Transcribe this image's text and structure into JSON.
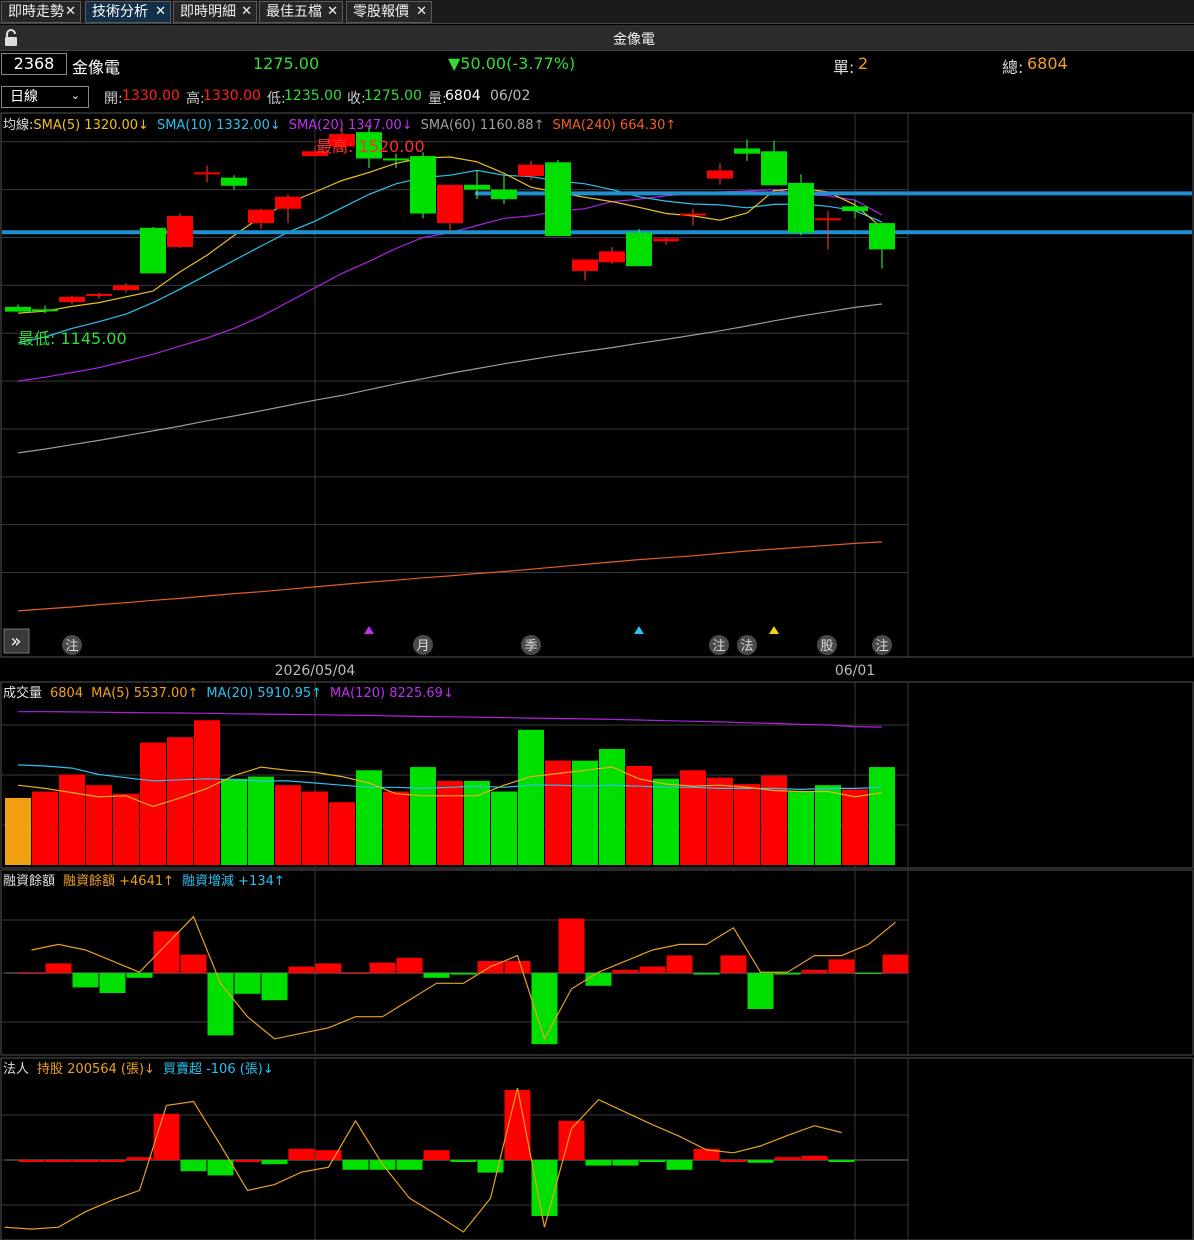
{
  "tabs": [
    {
      "label": "即時走勢",
      "active": false
    },
    {
      "label": "技術分析",
      "active": true
    },
    {
      "label": "即時明細",
      "active": false
    },
    {
      "label": "最佳五檔",
      "active": false
    },
    {
      "label": "零股報價",
      "active": false
    }
  ],
  "close_glyph": "✕",
  "window_title": "金像電",
  "quote": {
    "code": "2368",
    "name": "金像電",
    "price": "1275.00",
    "change": "▼50.00(-3.77%)",
    "single_label": "單:",
    "single_value": "2",
    "total_label": "總:",
    "total_value": "6804"
  },
  "bar": {
    "period": "日線",
    "open_label": "開:",
    "open": "1330.00",
    "high_label": "高:",
    "high": "1330.00",
    "low_label": "低:",
    "low": "1235.00",
    "close_label": "收:",
    "close": "1275.00",
    "vol_label": "量:",
    "vol": "6804",
    "date": "06/02"
  },
  "price_panel": {
    "legend": [
      {
        "text": "均線:",
        "color": "#e0e0e0"
      },
      {
        "text": "SMA(5) 1320.00↓",
        "color": "#f0c020"
      },
      {
        "text": "SMA(10) 1332.00↓",
        "color": "#2ec0f0"
      },
      {
        "text": "SMA(20) 1347.00↓",
        "color": "#c030f0"
      },
      {
        "text": "SMA(60) 1160.88↑",
        "color": "#a0a0a0"
      },
      {
        "text": "SMA(240) 664.30↑",
        "color": "#f06020"
      }
    ],
    "max_label": "最高: 1520.00",
    "min_label": "最低: 1145.00",
    "event_badges": [
      "注",
      "月",
      "季",
      "注",
      "法",
      "股",
      "注"
    ],
    "nav_glyph": "»",
    "x_labels": [
      "2026/05/04",
      "06/01"
    ]
  },
  "volume_panel": {
    "legend": [
      {
        "text": "成交量",
        "color": "#e0e0e0"
      },
      {
        "text": "6804",
        "color": "#f0a020"
      },
      {
        "text": "MA(5) 5537.00↑",
        "color": "#f0a020"
      },
      {
        "text": "MA(20) 5910.95↑",
        "color": "#2ec0f0"
      },
      {
        "text": "MA(120) 8225.69↓",
        "color": "#c030f0"
      }
    ]
  },
  "margin_panel": {
    "legend": [
      {
        "text": "融資餘額",
        "color": "#e0e0e0"
      },
      {
        "text": "融資餘額 +4641↑",
        "color": "#f0a020"
      },
      {
        "text": "融資增減 +134↑",
        "color": "#2ec0f0"
      }
    ]
  },
  "inst_panel": {
    "legend": [
      {
        "text": "法人",
        "color": "#e0e0e0"
      },
      {
        "text": "持股 200564 (張)↓",
        "color": "#f0a020"
      },
      {
        "text": "買賣超 -106 (張)↓",
        "color": "#2ec0f0"
      }
    ]
  },
  "colors": {
    "up": "#ff0000",
    "down": "#00e000",
    "grid": "#3a3a3a",
    "hline": "#1f8fd0"
  },
  "chart_data": [
    {
      "type": "candlestick",
      "title": "金像電 日線",
      "candles": [
        {
          "o": 1155,
          "h": 1160,
          "l": 1145,
          "c": 1145
        },
        {
          "o": 1150,
          "h": 1158,
          "l": 1142,
          "c": 1148
        },
        {
          "o": 1165,
          "h": 1178,
          "l": 1160,
          "c": 1176
        },
        {
          "o": 1178,
          "h": 1185,
          "l": 1172,
          "c": 1182
        },
        {
          "o": 1190,
          "h": 1204,
          "l": 1185,
          "c": 1200
        },
        {
          "o": 1320,
          "h": 1322,
          "l": 1225,
          "c": 1225
        },
        {
          "o": 1280,
          "h": 1350,
          "l": 1278,
          "c": 1345
        },
        {
          "o": 1435,
          "h": 1450,
          "l": 1415,
          "c": 1436
        },
        {
          "o": 1425,
          "h": 1430,
          "l": 1400,
          "c": 1408
        },
        {
          "o": 1330,
          "h": 1360,
          "l": 1318,
          "c": 1358
        },
        {
          "o": 1360,
          "h": 1390,
          "l": 1330,
          "c": 1385
        },
        {
          "o": 1470,
          "h": 1490,
          "l": 1470,
          "c": 1480
        },
        {
          "o": 1490,
          "h": 1528,
          "l": 1480,
          "c": 1516
        },
        {
          "o": 1520,
          "h": 1530,
          "l": 1445,
          "c": 1465
        },
        {
          "o": 1465,
          "h": 1475,
          "l": 1445,
          "c": 1462
        },
        {
          "o": 1470,
          "h": 1478,
          "l": 1340,
          "c": 1350
        },
        {
          "o": 1330,
          "h": 1355,
          "l": 1310,
          "c": 1410
        },
        {
          "o": 1410,
          "h": 1440,
          "l": 1380,
          "c": 1400
        },
        {
          "o": 1400,
          "h": 1430,
          "l": 1370,
          "c": 1380
        },
        {
          "o": 1428,
          "h": 1460,
          "l": 1420,
          "c": 1452
        },
        {
          "o": 1457,
          "h": 1462,
          "l": 1303,
          "c": 1303
        },
        {
          "o": 1230,
          "h": 1250,
          "l": 1210,
          "c": 1254
        },
        {
          "o": 1248,
          "h": 1280,
          "l": 1245,
          "c": 1271
        },
        {
          "o": 1310,
          "h": 1318,
          "l": 1240,
          "c": 1240
        },
        {
          "o": 1292,
          "h": 1300,
          "l": 1285,
          "c": 1298
        },
        {
          "o": 1348,
          "h": 1360,
          "l": 1325,
          "c": 1350
        },
        {
          "o": 1423,
          "h": 1455,
          "l": 1410,
          "c": 1440
        },
        {
          "o": 1486,
          "h": 1505,
          "l": 1460,
          "c": 1475
        },
        {
          "o": 1480,
          "h": 1502,
          "l": 1409,
          "c": 1409
        },
        {
          "o": 1414,
          "h": 1432,
          "l": 1305,
          "c": 1310
        },
        {
          "o": 1340,
          "h": 1355,
          "l": 1275,
          "c": 1340
        },
        {
          "o": 1365,
          "h": 1377,
          "l": 1340,
          "c": 1355
        },
        {
          "o": 1330,
          "h": 1330,
          "l": 1235,
          "c": 1275
        }
      ],
      "sma5": [
        1142,
        1146,
        1156,
        1164,
        1176,
        1188,
        1228,
        1263,
        1304,
        1343,
        1372,
        1395,
        1419,
        1436,
        1455,
        1466,
        1468,
        1458,
        1434,
        1405,
        1394,
        1384,
        1375,
        1363,
        1350,
        1345,
        1336,
        1351,
        1398,
        1403,
        1395,
        1368,
        1320
      ],
      "sma10": [
        1080,
        1092,
        1110,
        1124,
        1140,
        1164,
        1192,
        1222,
        1252,
        1282,
        1311,
        1334,
        1362,
        1390,
        1412,
        1425,
        1430,
        1440,
        1430,
        1427,
        1418,
        1412,
        1400,
        1385,
        1376,
        1370,
        1368,
        1362,
        1369,
        1370,
        1365,
        1356,
        1332
      ],
      "sma20": [
        1000,
        1008,
        1018,
        1028,
        1042,
        1056,
        1073,
        1090,
        1110,
        1135,
        1165,
        1195,
        1225,
        1250,
        1277,
        1300,
        1310,
        1325,
        1340,
        1345,
        1355,
        1360,
        1375,
        1380,
        1387,
        1392,
        1395,
        1397,
        1400,
        1390,
        1387,
        1378,
        1347
      ],
      "sma60": [
        850,
        858,
        867,
        876,
        886,
        896,
        906,
        917,
        927,
        938,
        949,
        960,
        970,
        982,
        994,
        1005,
        1016,
        1026,
        1036,
        1045,
        1054,
        1062,
        1070,
        1079,
        1087,
        1096,
        1105,
        1115,
        1126,
        1136,
        1145,
        1154,
        1161
      ],
      "sma240": [
        520,
        524,
        528,
        533,
        537,
        542,
        546,
        551,
        556,
        560,
        565,
        570,
        575,
        580,
        584,
        589,
        593,
        598,
        602,
        607,
        612,
        617,
        622,
        627,
        631,
        635,
        640,
        645,
        649,
        653,
        657,
        661,
        664
      ],
      "hlines": [
        1392,
        1311
      ],
      "y_range": [
        480,
        1560
      ]
    },
    {
      "type": "bar",
      "title": "成交量",
      "values": [
        6300,
        6900,
        8500,
        7500,
        6700,
        11500,
        12000,
        13600,
        8100,
        8300,
        7500,
        6900,
        5900,
        8900,
        6900,
        9200,
        7900,
        7900,
        6900,
        12700,
        9800,
        9800,
        10900,
        9300,
        8100,
        8900,
        8200,
        7600,
        8400,
        6900,
        7500,
        7100,
        9200
      ],
      "up": [
        false,
        true,
        true,
        true,
        true,
        true,
        true,
        true,
        false,
        false,
        true,
        true,
        true,
        false,
        true,
        false,
        true,
        false,
        false,
        false,
        true,
        false,
        false,
        true,
        false,
        true,
        true,
        true,
        true,
        false,
        false,
        true,
        false
      ],
      "ma5": [
        7500,
        7200,
        6800,
        6400,
        6500,
        5500,
        6300,
        7200,
        8400,
        9200,
        8900,
        8700,
        8300,
        7700,
        6700,
        6500,
        6500,
        6500,
        7500,
        8300,
        8600,
        8900,
        9200,
        8100,
        7600,
        7400,
        7500,
        7300,
        7000,
        6900,
        6900,
        6400,
        6800
      ],
      "ma20": [
        9400,
        9300,
        9100,
        8500,
        8200,
        7900,
        8000,
        8100,
        8000,
        7900,
        7900,
        7700,
        7500,
        7300,
        7300,
        7200,
        7300,
        7400,
        7300,
        7500,
        7500,
        7400,
        7500,
        7400,
        7300,
        7300,
        7200,
        7200,
        7200,
        7100,
        7200,
        7200,
        7300
      ],
      "ma120": [
        14400,
        14400,
        14380,
        14350,
        14330,
        14300,
        14280,
        14250,
        14200,
        14180,
        14150,
        14120,
        14080,
        14050,
        14000,
        13950,
        13920,
        13880,
        13850,
        13800,
        13760,
        13720,
        13680,
        13620,
        13560,
        13500,
        13440,
        13360,
        13300,
        13220,
        13150,
        13000,
        12950
      ],
      "y_range": [
        0,
        15500
      ]
    },
    {
      "type": "bar",
      "title": "融資餘額",
      "change": [
        0,
        120,
        -180,
        -250,
        -60,
        520,
        230,
        -780,
        -260,
        -340,
        80,
        120,
        0,
        130,
        190,
        -60,
        -20,
        150,
        150,
        -890,
        680,
        -160,
        40,
        80,
        220,
        -20,
        220,
        -450,
        -20,
        40,
        170,
        -10,
        230
      ],
      "balance": [
        3400,
        3500,
        3400,
        3200,
        3000,
        3500,
        4000,
        2800,
        2200,
        1800,
        1900,
        2000,
        2200,
        2200,
        2500,
        2800,
        2800,
        3100,
        3300,
        1800,
        2700,
        3000,
        3200,
        3400,
        3500,
        3500,
        3800,
        3000,
        3000,
        3300,
        3300,
        3500,
        3900
      ],
      "y_range": [
        -900,
        1000
      ]
    },
    {
      "type": "bar",
      "title": "法人",
      "net": [
        0,
        0,
        0,
        0,
        20,
        330,
        -80,
        -110,
        0,
        -30,
        80,
        70,
        -70,
        -70,
        -70,
        70,
        -10,
        -90,
        500,
        -400,
        280,
        -40,
        -40,
        -10,
        -70,
        80,
        0,
        -20,
        20,
        30,
        -5
      ],
      "holding": [
        194000,
        193800,
        194000,
        195600,
        196800,
        197800,
        206600,
        207000,
        202500,
        197800,
        198400,
        199700,
        200200,
        205000,
        200500,
        197000,
        195300,
        193500,
        197000,
        208400,
        194000,
        204200,
        207200,
        205900,
        204600,
        203400,
        202000,
        201700,
        202400,
        203500,
        204500,
        203800
      ],
      "y_range": [
        -450,
        520
      ]
    }
  ]
}
